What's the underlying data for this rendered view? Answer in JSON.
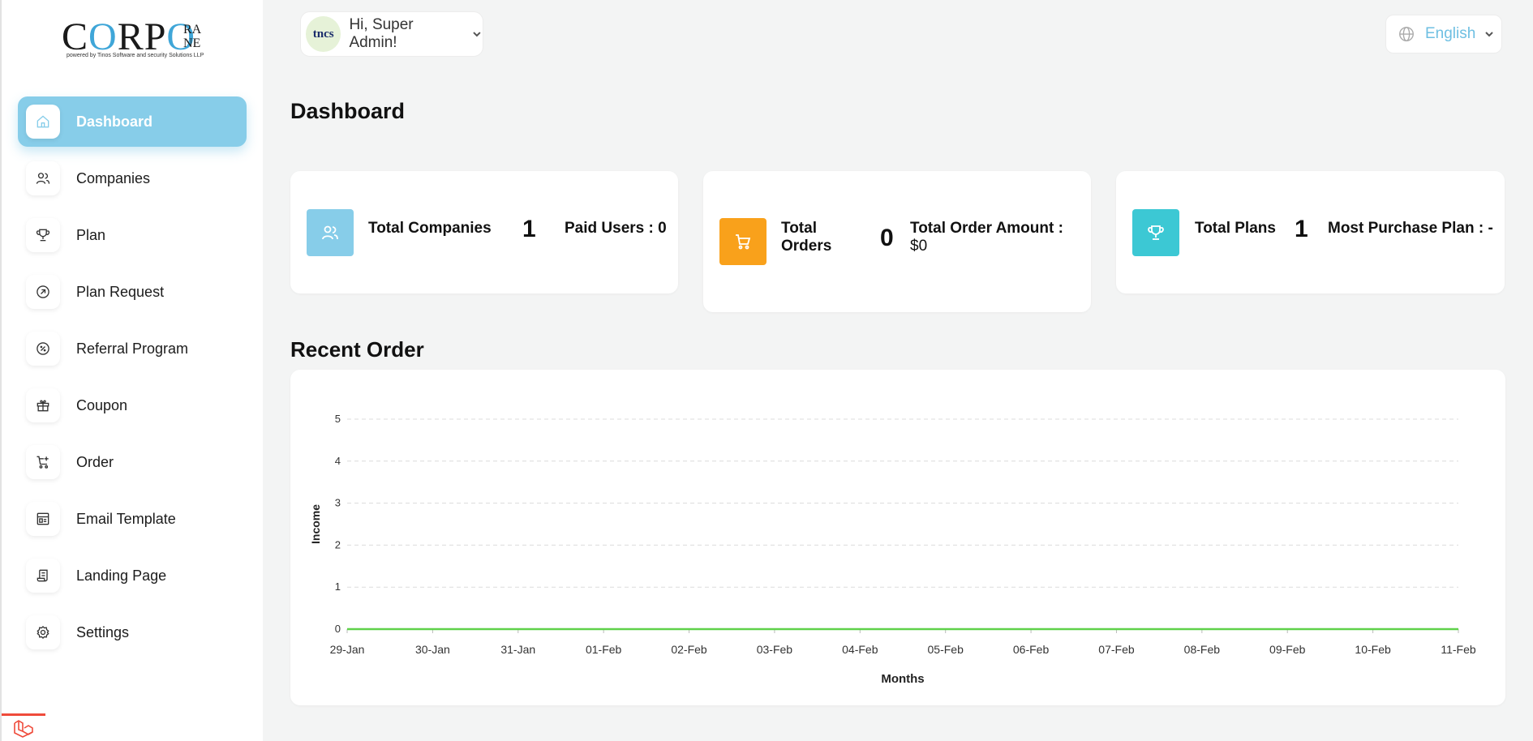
{
  "brand": {
    "logo_main": "CORPO",
    "logo_side_top": "RA",
    "logo_side_bottom": "NE",
    "logo_tagline": "powered by Tinos Software and security Solutions LLP"
  },
  "sidebar": {
    "items": [
      {
        "label": "Dashboard",
        "icon": "home-icon",
        "active": true
      },
      {
        "label": "Companies",
        "icon": "users-icon"
      },
      {
        "label": "Plan",
        "icon": "trophy-icon"
      },
      {
        "label": "Plan Request",
        "icon": "arrow-circle-icon"
      },
      {
        "label": "Referral Program",
        "icon": "discount-icon"
      },
      {
        "label": "Coupon",
        "icon": "gift-icon"
      },
      {
        "label": "Order",
        "icon": "cart-icon"
      },
      {
        "label": " Email Template",
        "icon": "template-icon"
      },
      {
        "label": "Landing Page",
        "icon": "document-icon"
      },
      {
        "label": "Settings",
        "icon": "gear-icon"
      }
    ]
  },
  "header": {
    "avatar_text": "tncs",
    "greeting": "Hi, Super Admin!",
    "language": "English"
  },
  "page": {
    "title": "Dashboard"
  },
  "stats": {
    "companies": {
      "label": "Total Companies",
      "value": "1",
      "extra": "Paid Users : 0",
      "color": "#87cde9"
    },
    "orders": {
      "label_line1": "Total",
      "label_line2": "Orders",
      "value": "0",
      "extra_line1": "Total Order Amount :",
      "extra_line2": "$0",
      "color": "#f9a11b"
    },
    "plans": {
      "label": "Total Plans",
      "value": "1",
      "extra": "Most Purchase Plan : -",
      "color": "#3cc8d4"
    }
  },
  "recent_order": {
    "title": "Recent Order"
  },
  "chart_data": {
    "type": "line",
    "xlabel": "Months",
    "ylabel": "Income",
    "categories": [
      "29-Jan",
      "30-Jan",
      "31-Jan",
      "01-Feb",
      "02-Feb",
      "03-Feb",
      "04-Feb",
      "05-Feb",
      "06-Feb",
      "07-Feb",
      "08-Feb",
      "09-Feb",
      "10-Feb",
      "11-Feb"
    ],
    "series": [
      {
        "values": [
          0,
          0,
          0,
          0,
          0,
          0,
          0,
          0,
          0,
          0,
          0,
          0,
          0,
          0
        ],
        "color": "#5fd14a"
      }
    ],
    "ylim": [
      0,
      5
    ],
    "yticks": [
      0,
      1,
      2,
      3,
      4,
      5
    ],
    "grid": true
  },
  "colors": {
    "accent": "#87cde9",
    "orange": "#f9a11b",
    "teal": "#3cc8d4",
    "laravel_red": "#ef4b3b"
  }
}
